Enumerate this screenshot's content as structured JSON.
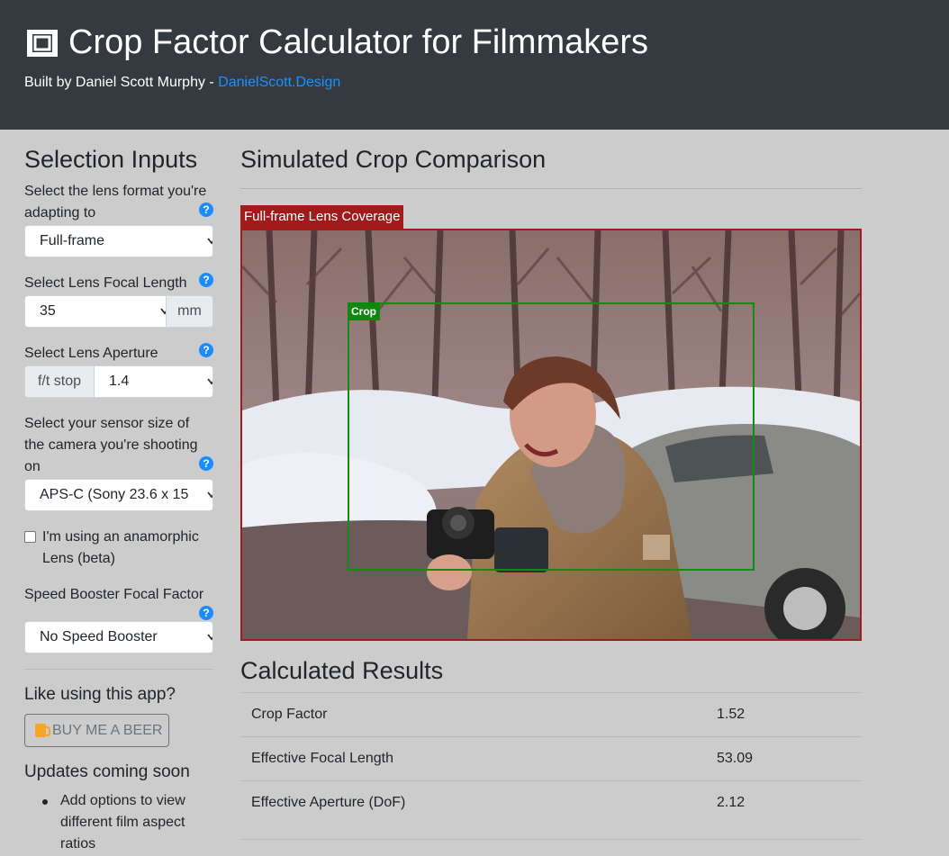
{
  "header": {
    "title": "Crop Factor Calculator for Filmmakers",
    "byline_prefix": "Built by Daniel Scott Murphy - ",
    "byline_link": "DanielScott.Design",
    "title_icon": "crop-frame-icon"
  },
  "sidebar": {
    "heading": "Selection Inputs",
    "lens_format": {
      "label": "Select the lens format you're adapting to",
      "value": "Full-frame"
    },
    "focal_length": {
      "label": "Select Lens Focal Length",
      "value": "35",
      "unit": "mm"
    },
    "aperture": {
      "label": "Select Lens Aperture",
      "prefix": "f/t stop",
      "value": "1.4"
    },
    "sensor": {
      "label": "Select your sensor size of the camera you're shooting on",
      "value": "APS-C (Sony 23.6 x 15"
    },
    "anamorphic": {
      "label": "I'm using an anamorphic Lens (beta)",
      "checked": false
    },
    "speed_booster": {
      "label": "Speed Booster Focal Factor",
      "value": "No Speed Booster"
    },
    "help_glyph": "?",
    "like_heading": "Like using this app?",
    "beer_button": "BUY ME A BEER",
    "updates_heading": "Updates coming soon",
    "updates": [
      "Add options to view different film aspect ratios"
    ]
  },
  "main": {
    "heading": "Simulated Crop Comparison",
    "coverage_label": "Full-frame Lens Coverage",
    "crop_label": "Crop",
    "results_heading": "Calculated Results",
    "results": [
      {
        "name": "Crop Factor",
        "value": "1.52"
      },
      {
        "name": "Effective Focal Length",
        "value": "53.09"
      },
      {
        "name": "Effective Aperture (DoF)",
        "value": "2.12"
      }
    ]
  },
  "colors": {
    "header_bg": "#343a40",
    "page_bg": "#cccccc",
    "link": "#1e90ff",
    "coverage_border": "#a01c1c",
    "crop_border": "#158a15",
    "help_icon": "#1a8cff"
  }
}
